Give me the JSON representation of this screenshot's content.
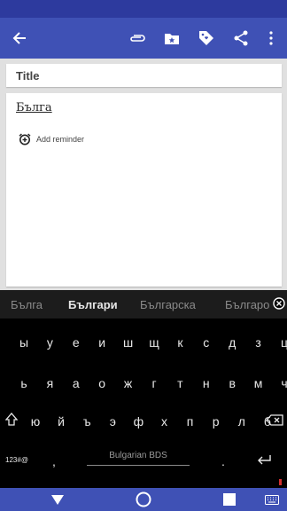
{
  "app_bar": {
    "icons": [
      "back-arrow-icon",
      "attachment-icon",
      "folder-star-icon",
      "tag-icon",
      "share-icon",
      "more-vert-icon"
    ]
  },
  "note": {
    "title_placeholder": "Title",
    "body_text": "Бълга",
    "add_reminder_label": "Add reminder",
    "reminder_icon": "alarm-add-icon"
  },
  "keyboard": {
    "suggestions": [
      "Бълга",
      "Българи",
      "Българска",
      "Българо"
    ],
    "row1": [
      "ы",
      "у",
      "е",
      "и",
      "ш",
      "щ",
      "к",
      "с",
      "д",
      "з",
      "ц"
    ],
    "row2": [
      "ь",
      "я",
      "а",
      "о",
      "ж",
      "г",
      "т",
      "н",
      "в",
      "м",
      "ч"
    ],
    "row3": [
      "ю",
      "й",
      "ъ",
      "э",
      "ф",
      "х",
      "п",
      "р",
      "л",
      "б"
    ],
    "symbols_key": "123#@",
    "comma_key": ",",
    "period_key": ".",
    "space_label": "Bulgarian BDS",
    "colors": {
      "background": "#000000",
      "key_text": "#e8e8e8"
    }
  },
  "nav_bar": {
    "icons": [
      "back-triangle-icon",
      "home-circle-icon",
      "recents-square-icon",
      "keyboard-switch-icon"
    ]
  },
  "colors": {
    "primary": "#3f51b5",
    "status_bar": "#2d3a9e"
  }
}
